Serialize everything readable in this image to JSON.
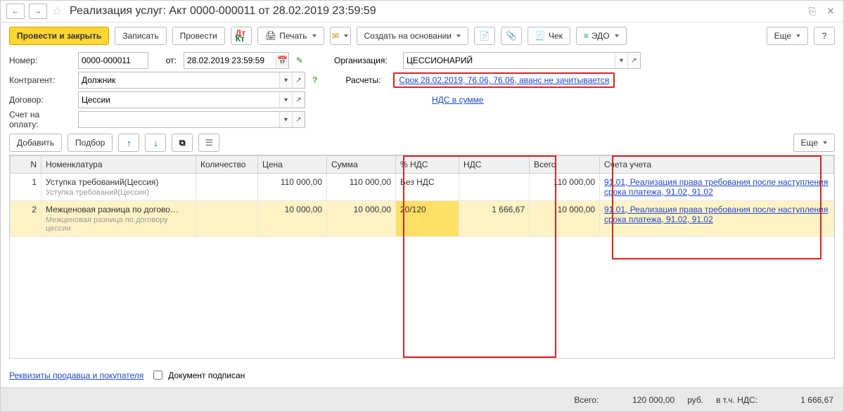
{
  "title": "Реализация услуг: Акт 0000-000011 от 28.02.2019 23:59:59",
  "nav": {
    "back": "←",
    "fwd": "→"
  },
  "toolbar": {
    "main": "Провести и закрыть",
    "save": "Записать",
    "post": "Провести",
    "print": "Печать",
    "create_based": "Создать на основании",
    "cheque": "Чек",
    "edo": "ЭДО",
    "more": "Еще",
    "help": "?"
  },
  "form": {
    "number_l": "Номер:",
    "number_v": "0000-000011",
    "from_l": "от:",
    "from_v": "28.02.2019 23:59:59",
    "org_l": "Организация:",
    "org_v": "ЦЕССИОНАРИЙ",
    "kontr_l": "Контрагент:",
    "kontr_v": "Должник",
    "calc_l": "Расчеты:",
    "calc_link": "Срок 28.02.2019, 76.06, 76.06, аванс не зачитывается",
    "vat_link": "НДС в сумме",
    "contract_l": "Договор:",
    "contract_v": "Цессии",
    "invoice_l": "Счет на оплату:",
    "invoice_v": ""
  },
  "table_toolbar": {
    "add": "Добавить",
    "pick": "Подбор",
    "more": "Еще"
  },
  "columns": {
    "n": "N",
    "nom": "Номенклатура",
    "qty": "Количество",
    "price": "Цена",
    "sum": "Сумма",
    "vatp": "% НДС",
    "vat": "НДС",
    "total": "Всего",
    "acc": "Счета учета"
  },
  "rows": [
    {
      "n": "1",
      "nom": "Уступка требований(Цессия)",
      "nom_sub": "Уступка требований(Цессия)",
      "qty": "",
      "price": "110 000,00",
      "sum": "110 000,00",
      "vatp": "Без НДС",
      "vat": "",
      "total": "110 000,00",
      "acc": "91.01, Реализация права требования после наступления срока платежа, 91.02, 91.02"
    },
    {
      "n": "2",
      "nom": "Межценовая разница по догово…",
      "nom_sub": "Межценовая разница по договору цессии",
      "qty": "",
      "price": "10 000,00",
      "sum": "10 000,00",
      "vatp": "20/120",
      "vat": "1 666,67",
      "total": "10 000,00",
      "acc": "91.01, Реализация права требования после наступления срока платежа, 91.02, 91.02"
    }
  ],
  "footer": {
    "req_link": "Реквизиты продавца и покупателя",
    "signed": "Документ подписан"
  },
  "totals": {
    "total_l": "Всего:",
    "total_v": "120 000,00",
    "cur": "руб.",
    "vat_l": "в т.ч. НДС:",
    "vat_v": "1 666,67"
  }
}
